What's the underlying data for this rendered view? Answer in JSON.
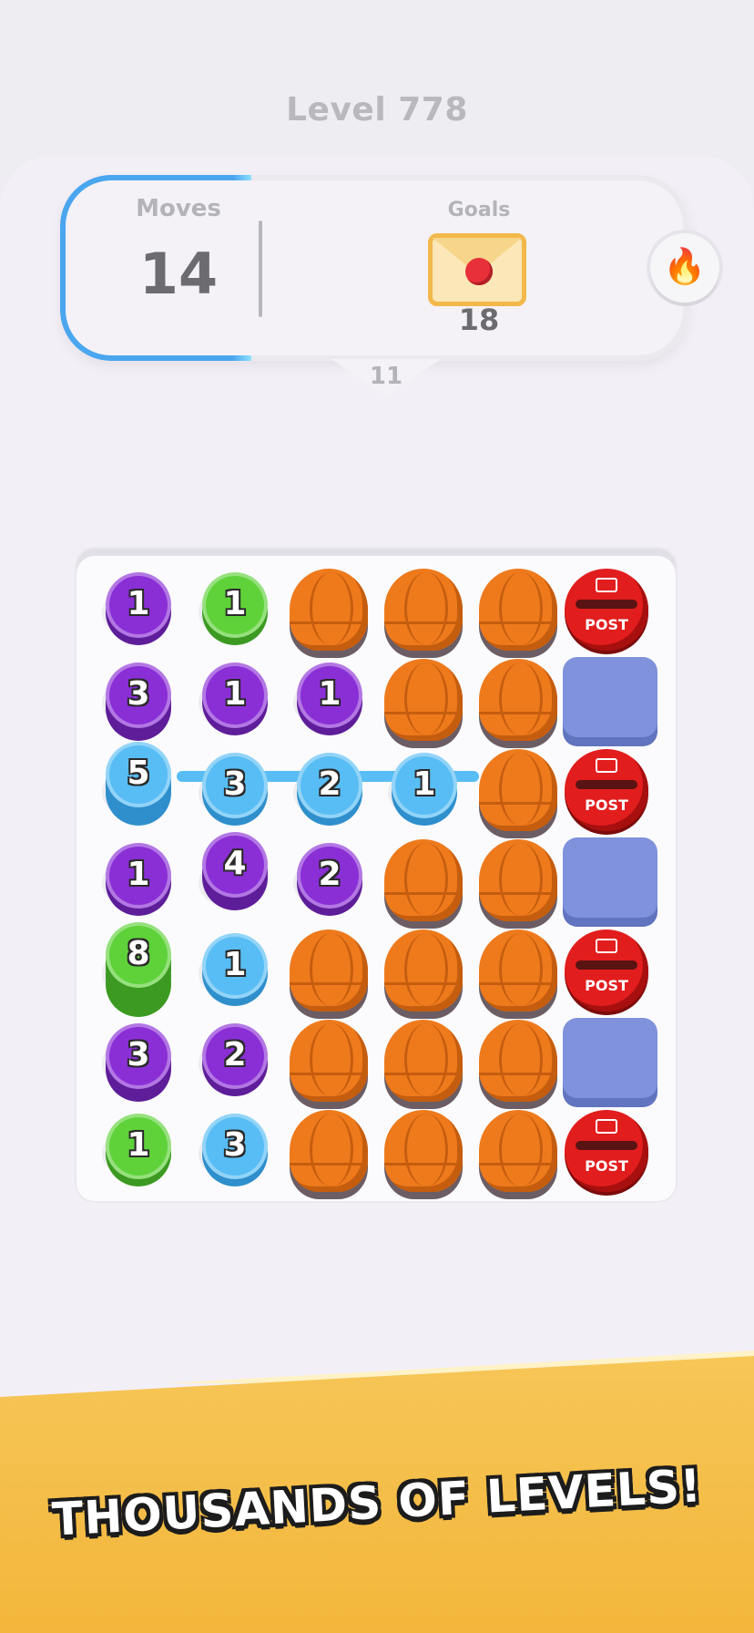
{
  "header": {
    "level_title": "Level 778"
  },
  "hud": {
    "moves_label": "Moves",
    "moves_value": "14",
    "goals_label": "Goals",
    "goal_icon": "envelope-icon",
    "goals_value": "18",
    "notch_value": "11",
    "moves_progress_fraction": 0.25,
    "powerup_icon": "fire-icon"
  },
  "board": {
    "post_label": "POST",
    "rows": [
      [
        "purple:1",
        "green:1",
        "basket",
        "basket",
        "basket",
        "post"
      ],
      [
        "purple:3",
        "purple:1",
        "purple:1",
        "basket",
        "basket",
        "blocker"
      ],
      [
        "blue:5",
        "blue:3",
        "blue:2",
        "blue:1",
        "basket",
        "post"
      ],
      [
        "purple:1",
        "purple:4",
        "purple:2",
        "basket",
        "basket",
        "blocker"
      ],
      [
        "green:8",
        "blue:1",
        "basket",
        "basket",
        "basket",
        "post"
      ],
      [
        "purple:3",
        "purple:2",
        "basket",
        "basket",
        "basket",
        "blocker"
      ],
      [
        "green:1",
        "blue:3",
        "basket",
        "basket",
        "basket",
        "post"
      ]
    ]
  },
  "banner": {
    "text": "THOUSANDS OF LEVELS!"
  },
  "colors": {
    "accent": "#4aa6ef",
    "purple": "#8a2fd6",
    "green": "#5fd23a",
    "blue": "#58bdf4",
    "basket": "#ee7a1c",
    "post": "#e21d1d",
    "blocker": "#7f92db",
    "banner": "#f3b63b"
  }
}
